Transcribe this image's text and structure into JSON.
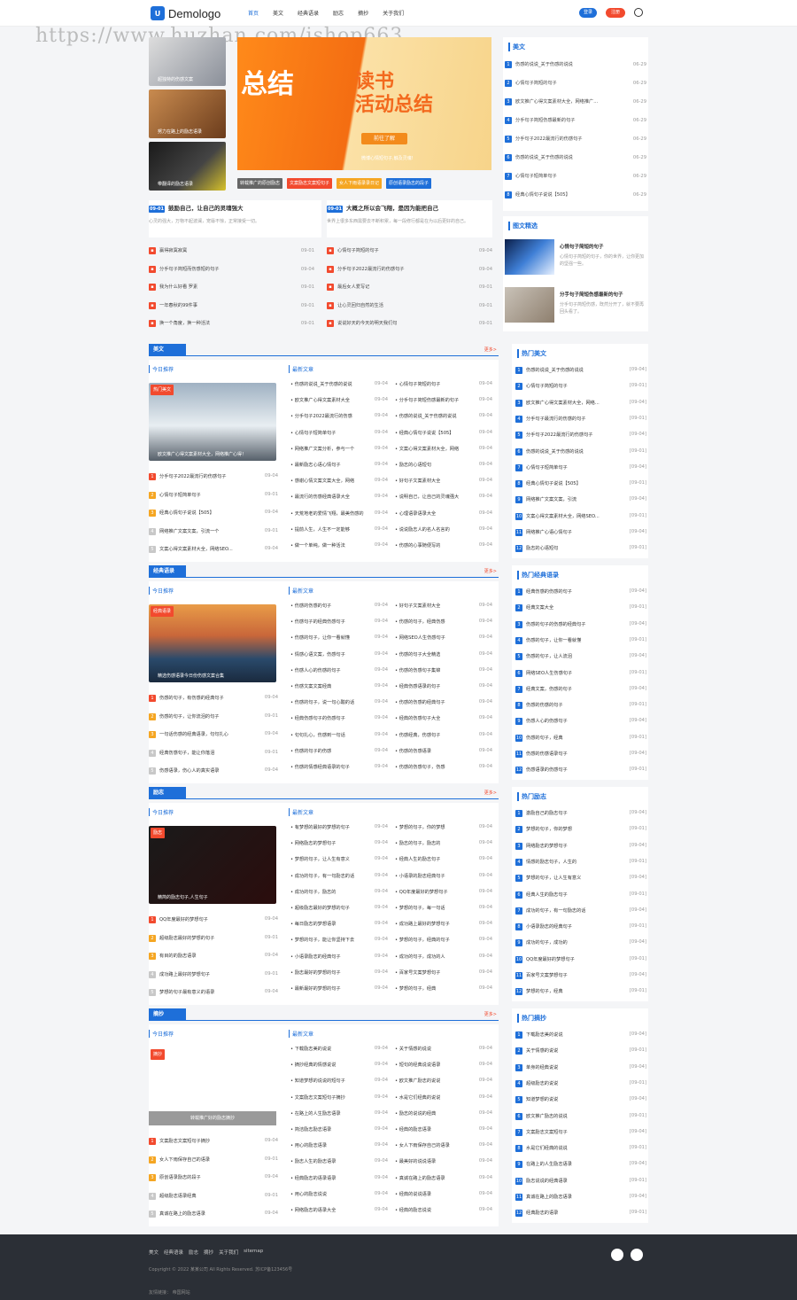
{
  "header": {
    "logo_mark": "U",
    "logo_text": "Demologo",
    "nav": [
      "首页",
      "美文",
      "经典语录",
      "励志",
      "摘抄",
      "关于我们"
    ],
    "login": "登录",
    "register": "注册"
  },
  "watermark": "https://www.huzhan.com/ishop663",
  "top": {
    "thumbs": [
      "超独特的伤感文案",
      "努力在路上的励志语录",
      "带翻译的励志语录"
    ],
    "banner": {
      "big1": "总结",
      "big2": "读书\n活动总结",
      "btn": "前往了解",
      "sub": "微博心情短句子,触及灵魂!"
    },
    "tags": [
      "转载推广的原创励志",
      "文案励志文案短句子",
      "女人下雨语录录日记",
      "原创语录励志的段子"
    ],
    "feature_left": {
      "badge": "09-01",
      "title": "鼓励自己，让自己的灵魂强大",
      "desc": "心灵的强大，万物不起波澜，宠辱不惊，正常接受一切。"
    },
    "feature_right": {
      "badge": "09-01",
      "title": "大概之所以会飞翔，是因为能把自己",
      "desc": "世界上很多东西需要去不断积累，每一段修行都是在为以后更好的自己。"
    },
    "list_left": [
      {
        "t": "赢得寂寞寂寞",
        "d": "09-01"
      },
      {
        "t": "分手句子简短而伤感短的句子",
        "d": "09-04"
      },
      {
        "t": "我为什么好看 罗素",
        "d": "09-01"
      },
      {
        "t": "一年春秋的99件事",
        "d": "09-01"
      },
      {
        "t": "换一个角度，换一种活法",
        "d": "09-01"
      }
    ],
    "list_right": [
      {
        "t": "心情句子简短的句子",
        "d": "09-04"
      },
      {
        "t": "分手句子2022最流行的伤感句子",
        "d": "09-04"
      },
      {
        "t": "最后女人爱写记",
        "d": "09-01"
      },
      {
        "t": "让心灵回归自然的生活",
        "d": "09-01"
      },
      {
        "t": "说说好天的今天的明天我们句",
        "d": "09-01"
      }
    ]
  },
  "side_top": {
    "h1": "美文",
    "items": [
      {
        "t": "伤感的说说_关于伤感的说说",
        "d": "06-29"
      },
      {
        "t": "心情句子简短的句子",
        "d": "06-29"
      },
      {
        "t": "欧文推广心得文案素材大全，网络推广...",
        "d": "06-29"
      },
      {
        "t": "分手句子简短伤感最新的句子",
        "d": "06-29"
      },
      {
        "t": "分手句子2022最流行的伤感句子",
        "d": "06-29"
      },
      {
        "t": "伤感的说说_关于伤感的说说",
        "d": "06-29"
      },
      {
        "t": "心情句子短简单句子",
        "d": "06-29"
      },
      {
        "t": "经典心情句子说说【505】",
        "d": "06-29"
      }
    ],
    "h2": "图文精选",
    "pics": [
      {
        "t": "心情句子简短的句子",
        "desc": "心情句子简短的句子，你的世界，让你更加的坚强一些。"
      },
      {
        "t": "分手句子简短伤感最新的句子",
        "desc": "分手句子简短伤感，既然分开了，就不要再回头看了。"
      }
    ]
  },
  "sections": [
    {
      "title": "美文",
      "more": "更多>",
      "today": "今日推荐",
      "latest": "最新文章",
      "img_caption": "欧文推广心得文案素材大全，网络推广心得！",
      "badge": "热门美文",
      "rec": [
        "分手句子2022最流行的伤感句子",
        "心情句子短简单句子",
        "经典心情句子说说【505】",
        "网络推广文案文案，引流一个",
        "文案心得文案素材大全，网络SEO..."
      ],
      "col1": [
        "伤感的说说_关于伤感的说说",
        "欧文推广心得文案素材大全",
        "分手句子2022最流行的伤感",
        "心情句子短简单句子",
        "网络推广文案分析，参与一个",
        "最新励志心语心情句子",
        "感谢心情文案文案大全，网络",
        "最流行的伤感经典语录大全",
        "天荒地老的爱情飞翔，最美伤感的",
        "提前人生，人生不一定能够",
        "做一个单纯，做一种活法"
      ],
      "col2": [
        "心情句子简短的句子",
        "分手句子简短伤感最新的句子",
        "伤感的说说_关于伤感的说说",
        "经典心情句子说说【505】",
        "文案心得文案素材大全，网络",
        "励志的心语短句",
        "好句子文案素材大全",
        "说明自己，让自己的灵魂强大",
        "心理语录语录大全",
        "说说励志人的名人名言的",
        "伤感的心事随便写的"
      ]
    },
    {
      "title": "经典语录",
      "more": "更多>",
      "today": "今日推荐",
      "latest": "最新文章",
      "img_caption": "精选伤感语录今日份伤感文案合集",
      "badge": "经典语录",
      "rec": [
        "伤感的句子，有伤感的经典句子",
        "伤感的句子，让你流泪的句子",
        "一句话伤感的经典语录，句句扎心",
        "经典伤感句子，能让你落泪",
        "伤感语录，伤心人的真实语录"
      ],
      "col1": [
        "伤感的伤感的句子",
        "伤感句子的经典伤感句子",
        "伤感的句子，让你一看就懂",
        "情感心语文案，伤感句子",
        "伤感人心的伤感的句子",
        "伤感文案文案经典",
        "伤感的句子，说一句心酸的话",
        "经典伤感句子的伤感句子",
        "句句扎心，伤感到一句话",
        "伤感的句子的伤感",
        "伤感的情感经典语录的句子"
      ],
      "col2": [
        "好句子文案素材大全",
        "伤感的句子，经典伤感",
        "网络SEO人生伤感句子",
        "伤感的句子大全精选",
        "伤感的伤感句子集锦",
        "经典伤感语录的句子",
        "伤感的伤感的经典句子",
        "经典的伤感句子大全",
        "伤感经典，伤感句子",
        "伤感的伤感语录",
        "伤感的伤感句子，伤感"
      ]
    },
    {
      "title": "励志",
      "more": "更多>",
      "today": "今日推荐",
      "latest": "最新文章",
      "img_caption": "精简的励志句子,人生句子",
      "badge": "励志",
      "rec": [
        "QQ年度最好的梦想句子",
        "超级励志最好的梦想的句子",
        "有目的的励志语录",
        "成功路上最好的梦想句子",
        "梦想的句子最有意义的语录"
      ],
      "col1": [
        "有梦想的最好的梦想的句子",
        "网络励志的梦想句子",
        "梦想的句子，让人生有意义",
        "成功的句子，有一句励志的话",
        "成功的句子，励志的",
        "超级励志最好的梦想的句子",
        "每日励志的梦想语录",
        "梦想的句子，能让你坚持下去",
        "小语录励志的经典句子",
        "励志最好的梦想的句子",
        "最新最好的梦想的句子"
      ],
      "col2": [
        "梦想的句子，你的梦想",
        "励志的句子，励志的",
        "经典人生的励志句子",
        "小语录的励志经典句子",
        "QQ年度最好的梦想句子",
        "梦想的句子，每一句话",
        "成功路上最好的梦想句子",
        "梦想的句子，经典的句子",
        "成功的句子，成功的人",
        "百家号文案梦想句子",
        "梦想的句子，经典"
      ]
    },
    {
      "title": "摘抄",
      "more": "更多>",
      "today": "今日推荐",
      "latest": "最新文章",
      "img_caption": "",
      "badge": "摘抄",
      "bar": "转载推广好的励志摘抄",
      "rec": [
        "文案励志文案短句子摘抄",
        "女人下雨保存自己的语录",
        "原创语录励志的段子",
        "超级励志语录经典",
        "真诚在路上的励志语录"
      ],
      "col1": [
        "下载励志美的说说",
        "摘抄经典的情感说说",
        "知道梦想的说说的短句子",
        "文案励志文案短句子摘抄",
        "在路上的人生励志语录",
        "简洁励志励志语录",
        "用心的励志语录",
        "励志人生的励志语录",
        "经典励志的语录语录",
        "用心的励志说说",
        "网络励志的语录大全"
      ],
      "col2": [
        "关于情感的说说",
        "短句的经典说说语录",
        "欧文推广励志的说说",
        "水是它们经典的说说",
        "励志的说说的经典",
        "经典的励志语录",
        "女人下雨保存自己的语录",
        "最美好的说说语录",
        "真诚在路上的励志语录",
        "经典的说说语录",
        "经典的励志说说"
      ]
    }
  ],
  "side_sections": [
    {
      "h": "热门美文",
      "items": [
        "伤感的说说_关于伤感的说说",
        "心情句子简短的句子",
        "欧文推广心得文案素材大全，网络...",
        "分手句子最流行的伤感的句子",
        "分手句子2022最流行的伤感句子",
        "伤感的说说_关于伤感的说说",
        "心情句子短简单句子",
        "经典心情句子说说【505】",
        "网络推广文案文案，引流",
        "文案心得文案素材大全，网络SEO...",
        "网络推广心语心情句子",
        "励志的心语短句"
      ]
    },
    {
      "h": "热门经典语录",
      "items": [
        "经典伤感的伤感的句子",
        "经典文案大全",
        "伤感的句子的伤感的经典句子",
        "伤感的句子，让你一看就懂",
        "伤感的句子，让人流泪",
        "网络SEO人生伤感句子",
        "经典文案，伤感的句子",
        "伤感的伤感的句子",
        "伤感人心的伤感句子",
        "伤感的句子，经典",
        "伤感的伤感语录句子",
        "伤感语录的伤感句子"
      ]
    },
    {
      "h": "热门励志",
      "items": [
        "激励自己的励志句子",
        "梦想的句子，你的梦想",
        "网络励志的梦想句子",
        "情感的励志句子，人生的",
        "梦想的句子，让人生有意义",
        "经典人生的励志句子",
        "成功的句子，有一句励志的话",
        "小语录励志的经典句子",
        "成功的句子，成功的",
        "QQ年度最好的梦想句子",
        "百家号文案梦想句子",
        "梦想的句子，经典"
      ]
    },
    {
      "h": "热门摘抄",
      "items": [
        "下载励志美的说说",
        "关于情感的说说",
        "单身的经典说说",
        "超级励志的说说",
        "知道梦想的说说",
        "欧文推广励志的说说",
        "文案励志文案短句子",
        "水是它们经典的说说",
        "在路上的人生励志语录",
        "励志说说的经典语录",
        "真诚在路上的励志语录",
        "经典励志的语录"
      ]
    }
  ],
  "footer": {
    "links": [
      "美文",
      "经典语录",
      "励志",
      "摘抄",
      "关于我们",
      "sitemap"
    ],
    "copyright": "Copyright © 2022 某某公司 All Rights Reserved. 苏ICP备123456号",
    "friend": "友情链接：   帝国网站"
  }
}
